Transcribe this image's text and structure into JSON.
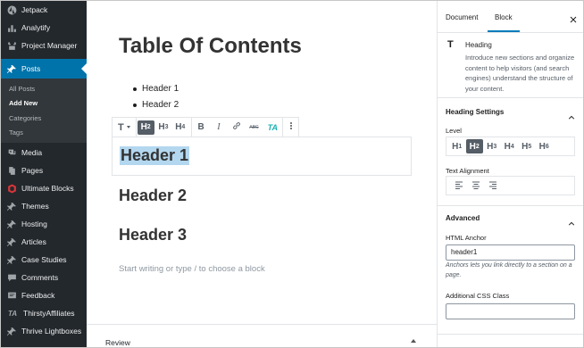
{
  "sidebar": {
    "items": [
      {
        "label": "Jetpack",
        "icon": "jetpack-icon"
      },
      {
        "label": "Analytify",
        "icon": "analytify-icon"
      },
      {
        "label": "Project Manager",
        "icon": "project-manager-icon"
      },
      {
        "label": "Posts",
        "icon": "pin-icon"
      },
      {
        "label": "Media",
        "icon": "media-icon"
      },
      {
        "label": "Pages",
        "icon": "pages-icon"
      },
      {
        "label": "Ultimate Blocks",
        "icon": "ultimate-blocks-icon"
      },
      {
        "label": "Themes",
        "icon": "pin-icon"
      },
      {
        "label": "Hosting",
        "icon": "pin-icon"
      },
      {
        "label": "Articles",
        "icon": "pin-icon"
      },
      {
        "label": "Case Studies",
        "icon": "pin-icon"
      },
      {
        "label": "Comments",
        "icon": "comment-icon"
      },
      {
        "label": "Feedback",
        "icon": "feedback-icon"
      },
      {
        "label": "ThirstyAffiliates",
        "icon": "ta-icon"
      },
      {
        "label": "Thrive Lightboxes",
        "icon": "pin-icon"
      }
    ],
    "submenu": [
      "All Posts",
      "Add New",
      "Categories",
      "Tags"
    ]
  },
  "editor": {
    "title": "Table Of Contents",
    "toc": [
      "Header 1",
      "Header 2"
    ],
    "toolbar": {
      "transform": "T",
      "levels": [
        {
          "h": "H",
          "n": "2"
        },
        {
          "h": "H",
          "n": "3"
        },
        {
          "h": "H",
          "n": "4"
        }
      ],
      "bold": "B",
      "italic": "I",
      "abc": "ABC",
      "ta": "TA"
    },
    "headings": [
      "Header 1",
      "Header 2",
      "Header 3"
    ],
    "placeholder": "Start writing or type / to choose a block",
    "review": "Review"
  },
  "settings": {
    "tabs": [
      "Document",
      "Block"
    ],
    "block_icon": "T",
    "block_title": "Heading",
    "block_desc": "Introduce new sections and organize content to help visitors (and search engines) understand the structure of your content.",
    "heading_settings": "Heading Settings",
    "level_label": "Level",
    "levels": [
      {
        "h": "H",
        "n": "1"
      },
      {
        "h": "H",
        "n": "2"
      },
      {
        "h": "H",
        "n": "3"
      },
      {
        "h": "H",
        "n": "4"
      },
      {
        "h": "H",
        "n": "5"
      },
      {
        "h": "H",
        "n": "6"
      }
    ],
    "active_level": "2",
    "text_alignment": "Text Alignment",
    "advanced": "Advanced",
    "html_anchor_label": "HTML Anchor",
    "html_anchor_value": "header1",
    "anchor_help": "Anchors lets you link directly to a section on a page.",
    "css_class_label": "Additional CSS Class",
    "css_class_value": ""
  },
  "colors": {
    "sidebar_bg": "#23282d",
    "active_menu": "#0073aa",
    "accent": "#007cba",
    "selection": "#b3d7ef",
    "ta_teal": "#1ab0b0",
    "ultimate_red": "#d63638"
  }
}
